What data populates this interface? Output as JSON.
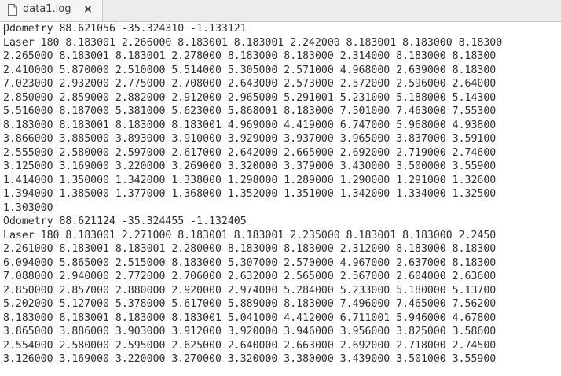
{
  "tab": {
    "title": "data1.log",
    "close_glyph": "×",
    "icon": "document-icon"
  },
  "editor": {
    "lines": [
      "Odometry 88.621056 -35.324310 -1.133121",
      "Laser 180 8.183001 2.266000 8.183001 8.183001 2.242000 8.183001 8.183000 8.18300",
      "2.265000 8.183001 8.183001 2.278000 8.183000 8.183000 2.314000 8.183000 8.18300",
      "2.410000 5.870000 2.510000 5.514000 5.305000 2.571000 4.968000 2.639000 8.18300",
      "7.023000 2.932000 2.775000 2.708000 2.643000 2.573000 2.572000 2.596000 2.64000",
      "2.850000 2.859000 2.882000 2.912000 2.965000 5.291001 5.231000 5.188000 5.14300",
      "5.516000 8.187000 5.381000 5.623000 5.868001 8.183000 7.501000 7.463000 7.55300",
      "8.183000 8.183001 8.183000 8.183001 4.969000 4.419000 6.747000 5.968000 4.93800",
      "3.866000 3.885000 3.893000 3.910000 3.929000 3.937000 3.965000 3.837000 3.59100",
      "2.555000 2.580000 2.597000 2.617000 2.642000 2.665000 2.692000 2.719000 2.74600",
      "3.125000 3.169000 3.220000 3.269000 3.320000 3.379000 3.430000 3.500000 3.55900",
      "1.414000 1.350000 1.342000 1.338000 1.298000 1.289000 1.290000 1.291000 1.32600",
      "1.394000 1.385000 1.377000 1.368000 1.352000 1.351000 1.342000 1.334000 1.32500",
      "1.303000",
      "Odometry 88.621124 -35.324455 -1.132405",
      "Laser 180 8.183001 2.271000 8.183001 8.183001 2.235000 8.183001 8.183000 2.2450",
      "2.261000 8.183001 8.183001 2.280000 8.183000 8.183000 2.312000 8.183000 8.18300",
      "6.094000 5.865000 2.515000 8.183000 5.307000 2.570000 4.967000 2.637000 8.18300",
      "7.088000 2.940000 2.772000 2.706000 2.632000 2.565000 2.567000 2.604000 2.63600",
      "2.850000 2.857000 2.880000 2.920000 2.974000 5.284000 5.233000 5.180000 5.13700",
      "5.202000 5.127000 5.378000 5.617000 5.889000 8.183000 7.496000 7.465000 7.56200",
      "8.183000 8.183001 8.183000 8.183001 5.041000 4.412000 6.711001 5.946000 4.67800",
      "3.865000 3.886000 3.903000 3.912000 3.920000 3.946000 3.956000 3.825000 3.58600",
      "2.554000 2.580000 2.595000 2.625000 2.640000 2.663000 2.692000 2.718000 2.74500",
      "3.126000 3.169000 3.220000 3.270000 3.320000 3.380000 3.439000 3.501000 3.55900"
    ]
  }
}
